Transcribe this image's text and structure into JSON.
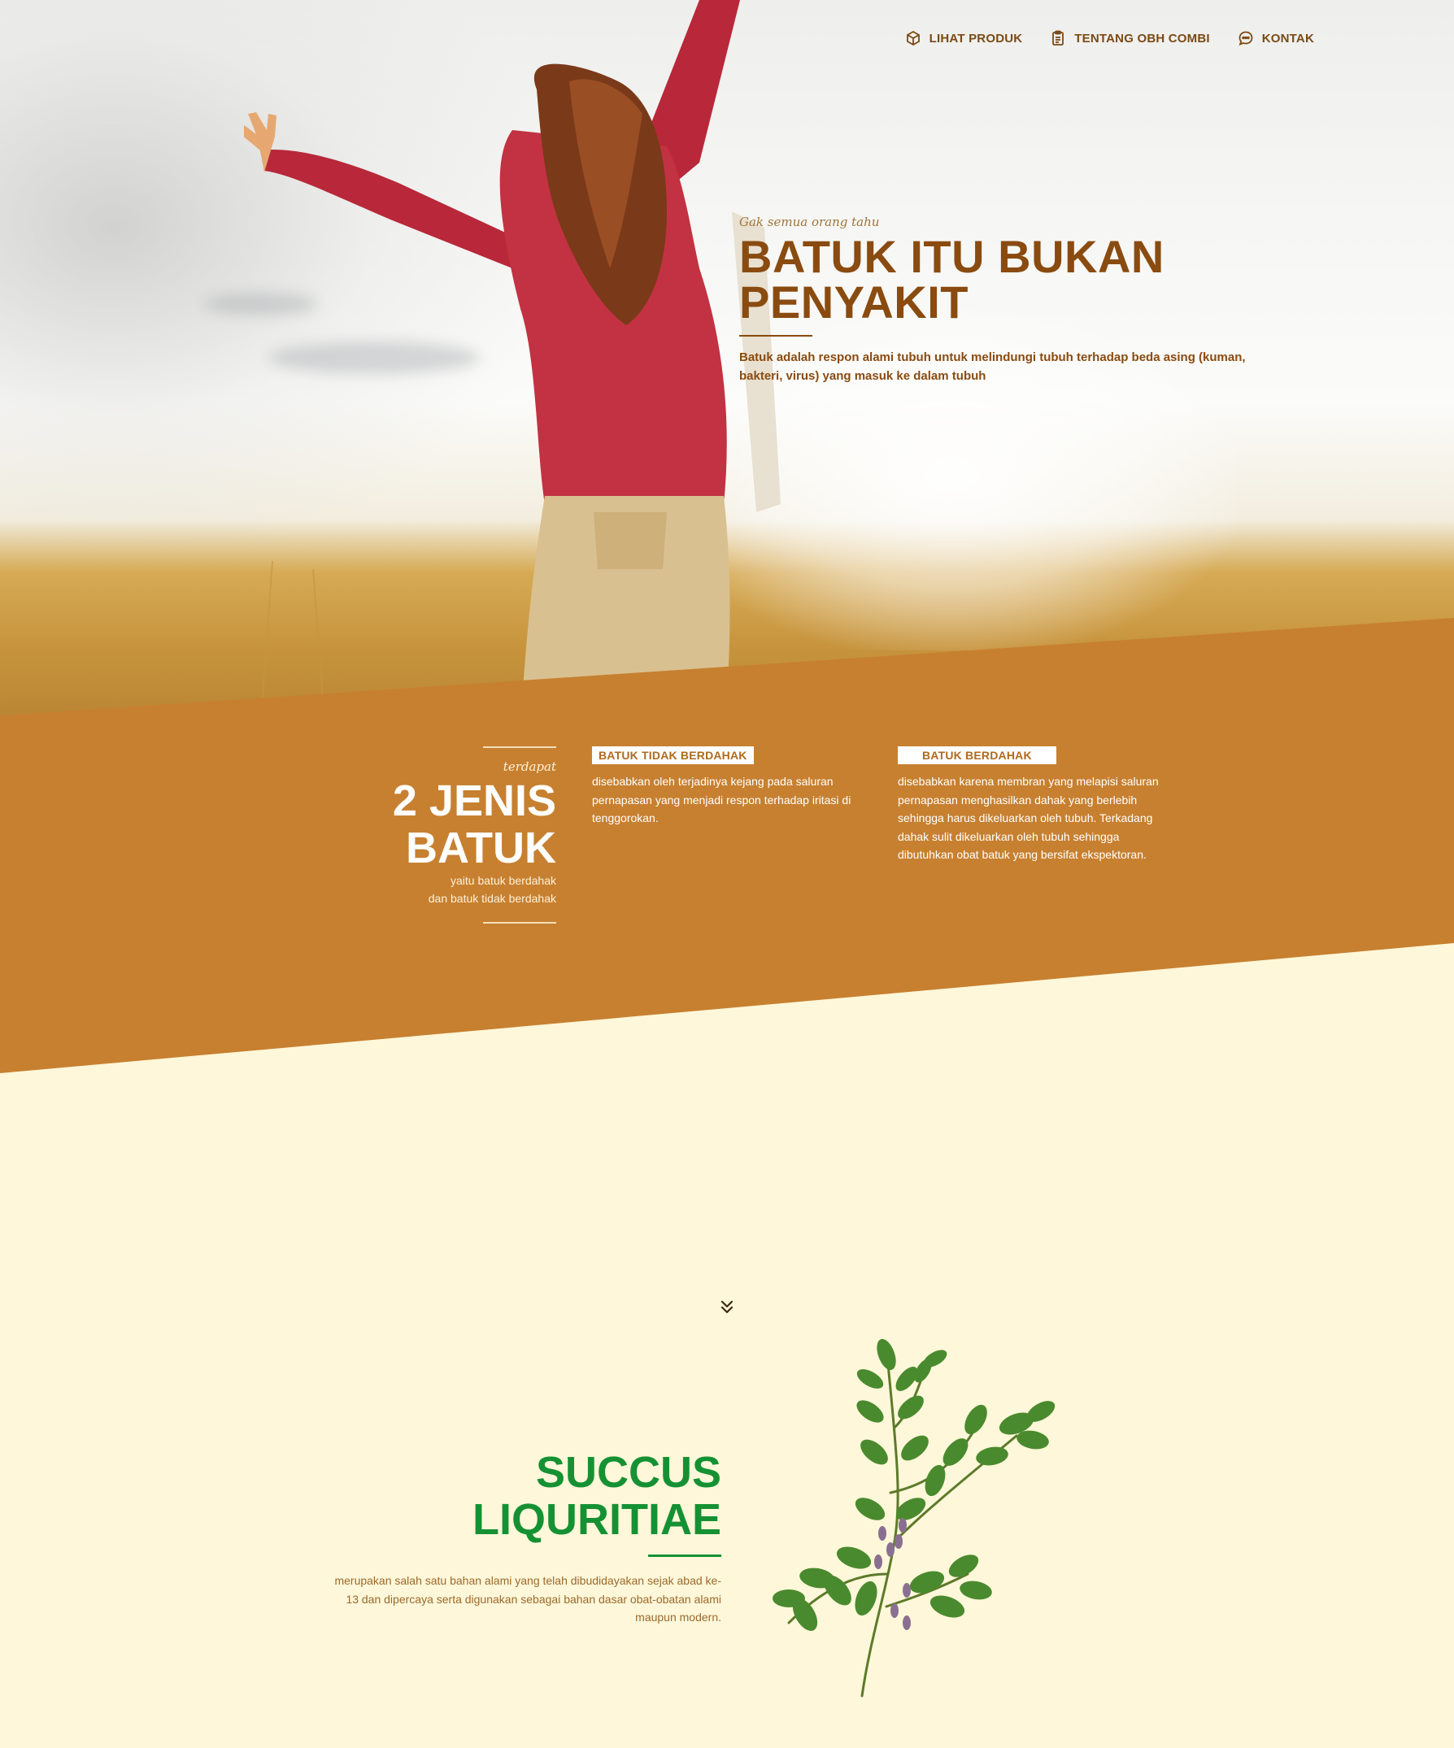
{
  "nav": {
    "items": [
      {
        "label": "LIHAT PRODUK",
        "icon": "package-icon"
      },
      {
        "label": "TENTANG OBH COMBI",
        "icon": "clipboard-icon"
      },
      {
        "label": "KONTAK",
        "icon": "chat-bubble-icon"
      }
    ]
  },
  "hero": {
    "eyebrow": "Gak semua orang tahu",
    "title_line1": "BATUK ITU BUKAN",
    "title_line2": "PENYAKIT",
    "description": "Batuk adalah respon alami tubuh untuk melindungi tubuh terhadap beda asing (kuman, bakteri, virus) yang masuk ke dalam tubuh"
  },
  "types": {
    "eyebrow": "terdapat",
    "title_line1": "2 JENIS",
    "title_line2": "BATUK",
    "sub_line1": "yaitu batuk berdahak",
    "sub_line2": "dan batuk tidak berdahak",
    "cards": [
      {
        "badge": "BATUK TIDAK BERDAHAK",
        "description": "disebabkan oleh terjadinya kejang pada saluran pernapasan yang menjadi respon terhadap iritasi di tenggorokan."
      },
      {
        "badge": "BATUK BERDAHAK",
        "description": "disebabkan karena membran yang melapisi saluran pernapasan menghasilkan dahak yang berlebih sehingga harus dikeluarkan oleh tubuh. Terkadang dahak sulit dikeluarkan oleh tubuh sehingga dibutuhkan obat batuk yang bersifat ekspektoran."
      }
    ]
  },
  "scroll": {
    "icon": "double-chevron-down-icon"
  },
  "ingredient": {
    "title_line1": "SUCCUS",
    "title_line2": "LIQURITIAE",
    "description": "merupakan salah satu bahan alami yang telah dibudidayakan sejak abad ke-13 dan dipercaya serta digunakan sebagai bahan dasar obat-obatan alami maupun modern.",
    "image_icon": "licorice-plant-illustration"
  },
  "colors": {
    "brand_brown": "#8a4b10",
    "band_orange": "#c78030",
    "cream_bg": "#fef7d9",
    "green": "#159134"
  }
}
